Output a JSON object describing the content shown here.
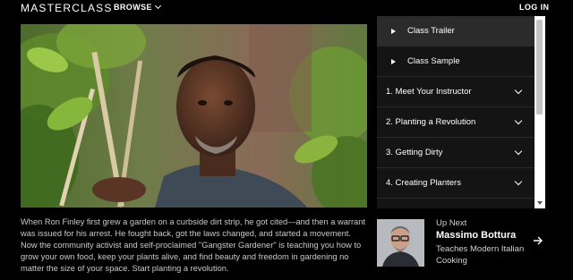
{
  "nav": {
    "logo": "MASTERCLASS",
    "browse": "BROWSE",
    "login": "LOG IN"
  },
  "lessons": {
    "items": [
      {
        "label": "Class Trailer",
        "kind": "clip",
        "active": true
      },
      {
        "label": "Class Sample",
        "kind": "clip",
        "active": false
      },
      {
        "label": "1. Meet Your Instructor",
        "kind": "chapter",
        "active": false
      },
      {
        "label": "2. Planting a Revolution",
        "kind": "chapter",
        "active": false
      },
      {
        "label": "3. Getting Dirty",
        "kind": "chapter",
        "active": false
      },
      {
        "label": "4. Creating Planters",
        "kind": "chapter",
        "active": false
      }
    ]
  },
  "description": "When Ron Finley first grew a garden on a curbside dirt strip, he got cited—and then a warrant was issued for his arrest. He fought back, got the laws changed, and started a movement. Now the community activist and self-proclaimed \"Gangster Gardener\" is teaching you how to grow your own food, keep your plants alive, and find beauty and freedom in gardening no matter the size of your space. Start planting a revolution.",
  "up_next": {
    "label": "Up Next",
    "name": "Massimo Bottura",
    "subtitle": "Teaches Modern Italian Cooking"
  },
  "colors": {
    "background": "#000000",
    "panel": "#141414",
    "active_row": "#2b2b2b",
    "text_muted": "#c9c9c9"
  }
}
